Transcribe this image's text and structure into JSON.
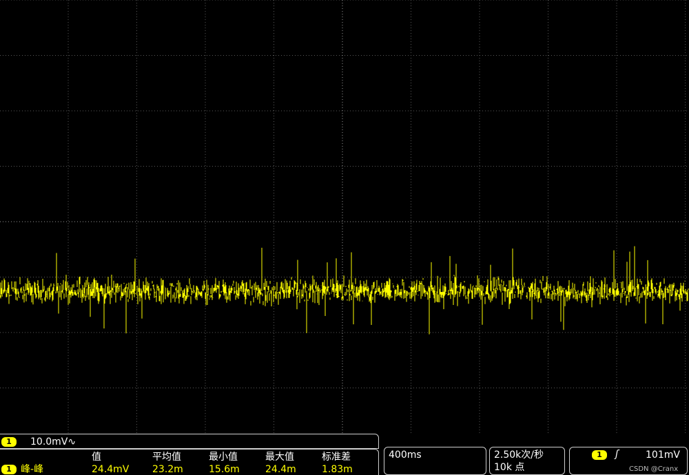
{
  "channel": {
    "number": "1",
    "scale": "10.0mV",
    "coupling_icon": "ac-coupling-icon",
    "coupling_glyph": "∿",
    "color": "#ffff00"
  },
  "measurement": {
    "name": "峰-峰",
    "headers": [
      "值",
      "平均值",
      "最小值",
      "最大值",
      "标准差"
    ],
    "values": [
      "24.4mV",
      "23.2m",
      "15.6m",
      "24.4m",
      "1.83m"
    ]
  },
  "timebase": {
    "value": "400ms"
  },
  "acquisition": {
    "rate": "2.50k次/秒",
    "points": "10k 点"
  },
  "trigger": {
    "source": "1",
    "slope_icon": "rising-edge-icon",
    "slope_glyph": "ʃ",
    "level": "101mV"
  },
  "watermark": "CSDN @Cranx",
  "chart_data": {
    "type": "line",
    "title": "",
    "xlabel": "",
    "ylabel": "",
    "grid": true,
    "grid_divisions": {
      "x": 10,
      "y": 8
    },
    "series": [
      {
        "name": "",
        "color": "#ffff00",
        "trace_level_div": -1.25,
        "noise_pkpk_mV": 24.4,
        "noise_mean_mV": 23.2
      }
    ]
  }
}
